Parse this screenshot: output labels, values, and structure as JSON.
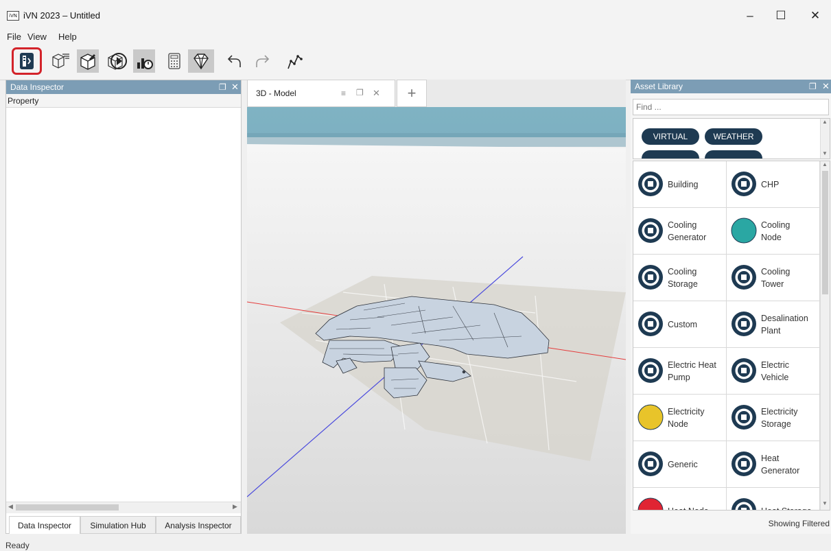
{
  "window": {
    "app_icon_text": "iVN",
    "title": "iVN 2023 – Untitled",
    "minimize": "–",
    "maximize": "☐",
    "close": "✕"
  },
  "menu": [
    "File",
    "View",
    "Help"
  ],
  "toolbar": {
    "icons": [
      "data-inspector-icon",
      "model-list-icon",
      "cube-edit-icon",
      "play-icon",
      "chart-icon",
      "calculator-icon",
      "diamond-icon",
      "undo-icon",
      "redo-icon",
      "route-icon"
    ],
    "highlighted": "data-inspector-icon"
  },
  "left_panel": {
    "title": "Data Inspector",
    "property_header": "Property",
    "tabs": [
      "Data Inspector",
      "Simulation Hub",
      "Analysis Inspector"
    ],
    "active_tab": "Data Inspector"
  },
  "view": {
    "tab_label": "3D - Model",
    "add_tab": "+"
  },
  "asset_library": {
    "title": "Asset Library",
    "find_placeholder": "Find ...",
    "filters": [
      "VIRTUAL",
      "WEATHER"
    ],
    "assets": [
      {
        "label": "Building",
        "icon": "building-icon",
        "color": "#1e3a52"
      },
      {
        "label": "CHP",
        "icon": "chp-icon",
        "color": "#1e3a52"
      },
      {
        "label": "Cooling\nGenerator",
        "icon": "cooling-generator-icon",
        "color": "#1e3a52"
      },
      {
        "label": "Cooling\nNode",
        "icon": "cooling-node-icon",
        "color": "#2aa7a3"
      },
      {
        "label": "Cooling\nStorage",
        "icon": "cooling-storage-icon",
        "color": "#1e3a52"
      },
      {
        "label": "Cooling\nTower",
        "icon": "cooling-tower-icon",
        "color": "#1e3a52"
      },
      {
        "label": "Custom",
        "icon": "custom-icon",
        "color": "#1e3a52"
      },
      {
        "label": "Desalination\nPlant",
        "icon": "desalination-plant-icon",
        "color": "#1e3a52"
      },
      {
        "label": "Electric Heat\nPump",
        "icon": "heat-pump-icon",
        "color": "#1e3a52"
      },
      {
        "label": "Electric\nVehicle",
        "icon": "electric-vehicle-icon",
        "color": "#1e3a52"
      },
      {
        "label": "Electricity\nNode",
        "icon": "electricity-node-icon",
        "color": "#e8c42a"
      },
      {
        "label": "Electricity\nStorage",
        "icon": "electricity-storage-icon",
        "color": "#1e3a52"
      },
      {
        "label": "Generic",
        "icon": "generic-icon",
        "color": "#1e3a52"
      },
      {
        "label": "Heat\nGenerator",
        "icon": "heat-generator-icon",
        "color": "#1e3a52"
      },
      {
        "label": "Heat Node",
        "icon": "heat-node-icon",
        "color": "#e02433"
      },
      {
        "label": "Heat Storage",
        "icon": "heat-storage-icon",
        "color": "#1e3a52"
      }
    ],
    "status": "Showing Filtered"
  },
  "statusbar": "Ready",
  "colors": {
    "panel_header": "#7c9db5",
    "accent_dark": "#1e3a52",
    "highlight": "#d3232a"
  }
}
